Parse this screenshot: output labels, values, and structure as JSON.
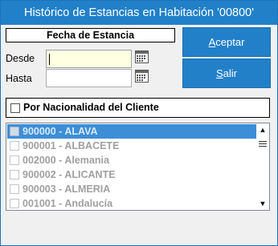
{
  "window": {
    "title": "Histórico de Estancias en Habitación '00800'"
  },
  "fecha": {
    "heading": "Fecha de Estancia",
    "desde_label": "Desde",
    "desde_value": "",
    "hasta_label": "Hasta",
    "hasta_value": ""
  },
  "buttons": {
    "aceptar_label": "ceptar",
    "aceptar_accel": "A",
    "salir_label": "alir",
    "salir_accel": "S"
  },
  "nacionalidad": {
    "label": "Por Nacionalidad del Cliente",
    "checked": false
  },
  "list": {
    "items": [
      {
        "label": "900000 - ALAVA",
        "checked": false
      },
      {
        "label": "900001 - ALBACETE",
        "checked": false
      },
      {
        "label": "002000 - Alemania",
        "checked": false
      },
      {
        "label": "900002 - ALICANTE",
        "checked": false
      },
      {
        "label": "900003 - ALMERIA",
        "checked": false
      },
      {
        "label": "001001 - Andalucía",
        "checked": false
      }
    ]
  },
  "colors": {
    "title_bar": "#2180c8",
    "button": "#2180c8",
    "selected_row": "#3c8ed6",
    "active_field": "#ffffe1"
  },
  "icons": {
    "calendar": "calendar-icon",
    "scroll_up": "chevron-up-icon",
    "scroll_down": "chevron-down-icon",
    "scroll_thumb": "grip-icon"
  }
}
